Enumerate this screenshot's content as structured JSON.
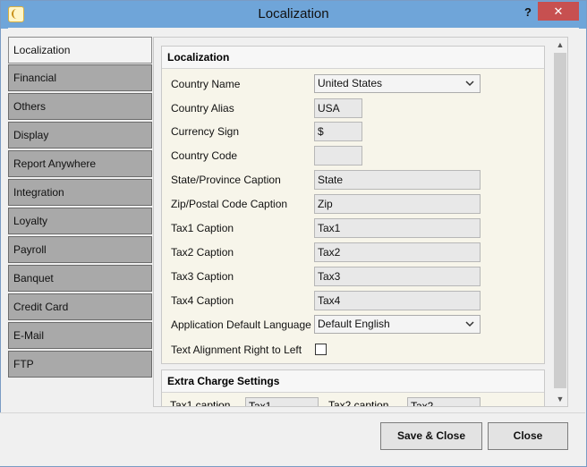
{
  "window": {
    "title": "Localization",
    "help": "?",
    "close": "✕"
  },
  "sidebar": {
    "items": [
      {
        "label": "Localization"
      },
      {
        "label": "Financial"
      },
      {
        "label": "Others"
      },
      {
        "label": "Display"
      },
      {
        "label": "Report Anywhere"
      },
      {
        "label": "Integration"
      },
      {
        "label": "Loyalty"
      },
      {
        "label": "Payroll"
      },
      {
        "label": "Banquet"
      },
      {
        "label": "Credit Card"
      },
      {
        "label": "E-Mail"
      },
      {
        "label": "FTP"
      }
    ],
    "active_index": 0
  },
  "localization": {
    "header": "Localization",
    "country_name_label": "Country Name",
    "country_name_value": "United States",
    "country_alias_label": "Country Alias",
    "country_alias_value": "USA",
    "currency_sign_label": "Currency Sign",
    "currency_sign_value": "$",
    "country_code_label": "Country Code",
    "country_code_value": "",
    "state_caption_label": "State/Province Caption",
    "state_caption_value": "State",
    "zip_caption_label": "Zip/Postal Code Caption",
    "zip_caption_value": "Zip",
    "tax1_label": "Tax1 Caption",
    "tax1_value": "Tax1",
    "tax2_label": "Tax2 Caption",
    "tax2_value": "Tax2",
    "tax3_label": "Tax3 Caption",
    "tax3_value": "Tax3",
    "tax4_label": "Tax4 Caption",
    "tax4_value": "Tax4",
    "language_label": "Application Default Language",
    "language_value": "Default English",
    "rtl_label": "Text Alignment Right to Left",
    "rtl_checked": false
  },
  "extra_charge": {
    "header": "Extra Charge Settings",
    "tax1_label": "Tax1 caption",
    "tax1_value": "Tax1",
    "tax2_label": "Tax2 caption",
    "tax2_value": "Tax2"
  },
  "footer": {
    "save_close": "Save & Close",
    "close": "Close"
  }
}
